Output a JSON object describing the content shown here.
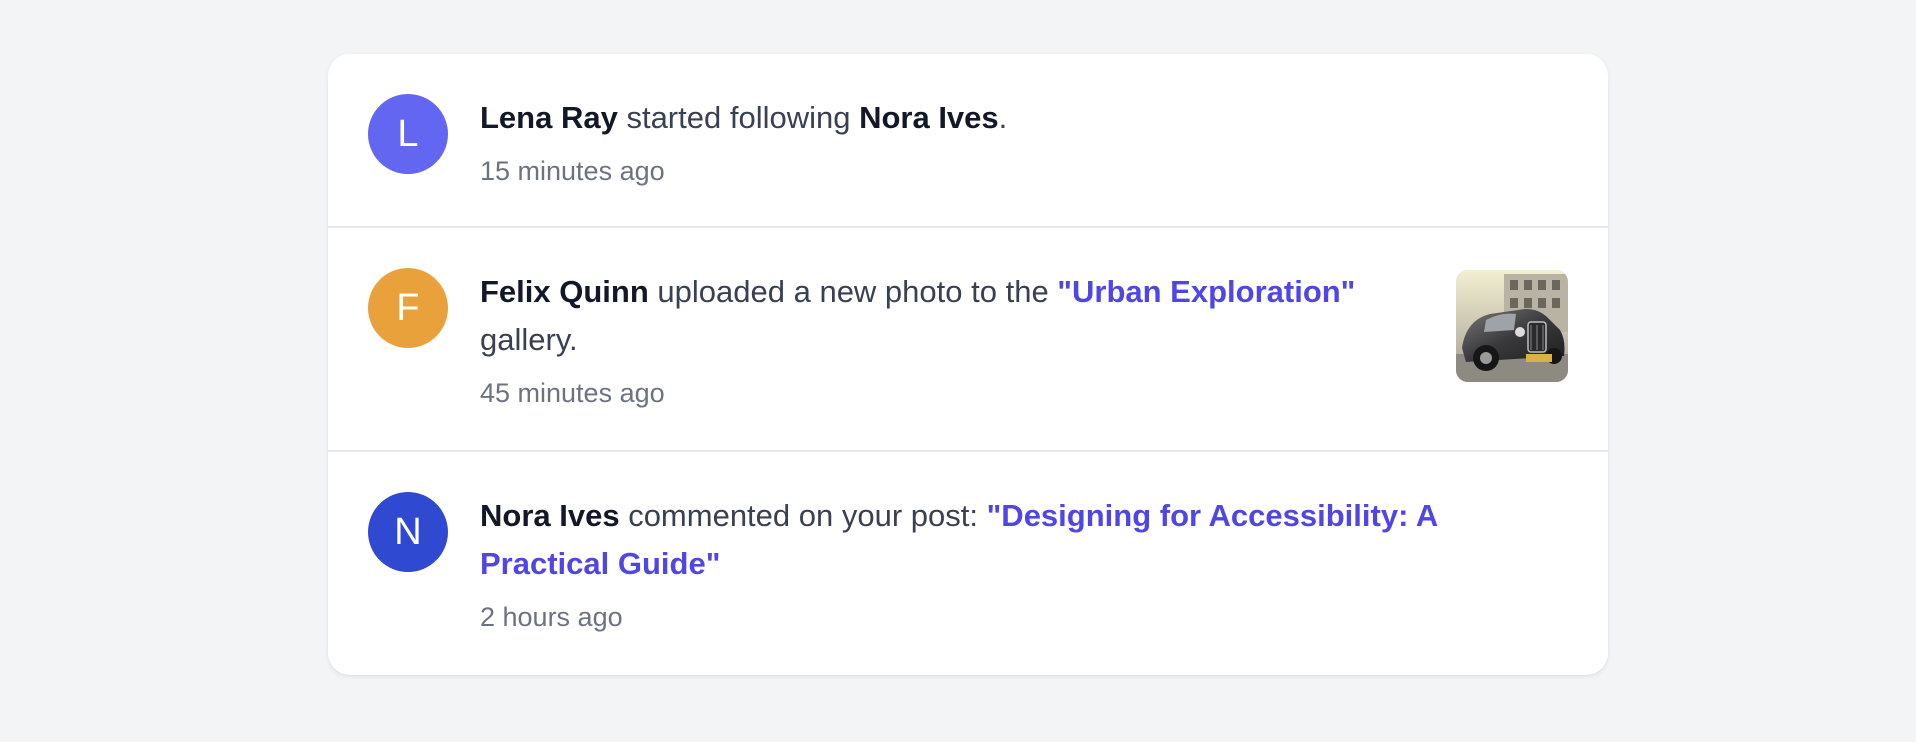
{
  "feed": {
    "items": [
      {
        "avatar_letter": "L",
        "avatar_color": "#6366f1",
        "actor": "Lena Ray",
        "action": " started following ",
        "target": "Nora Ives",
        "suffix": ".",
        "time": "15 minutes ago"
      },
      {
        "avatar_letter": "F",
        "avatar_color": "#e9a23b",
        "actor": "Felix Quinn",
        "action": " uploaded a new photo to the ",
        "link": "\"Urban Exploration\"",
        "suffix": " gallery.",
        "time": "45 minutes ago",
        "thumbnail_icon": "vintage-car-photo"
      },
      {
        "avatar_letter": "N",
        "avatar_color": "#2f49d1",
        "actor": "Nora Ives",
        "action": " commented on your post: ",
        "link": "\"Designing for Accessibility: A Practical Guide\"",
        "time": "2 hours ago"
      }
    ]
  },
  "colors": {
    "background": "#f3f4f6",
    "card": "#ffffff",
    "link": "#4f46e5",
    "text_strong": "#111827",
    "text_body": "#374151",
    "text_muted": "#6b7280",
    "divider": "#e5e7eb"
  }
}
